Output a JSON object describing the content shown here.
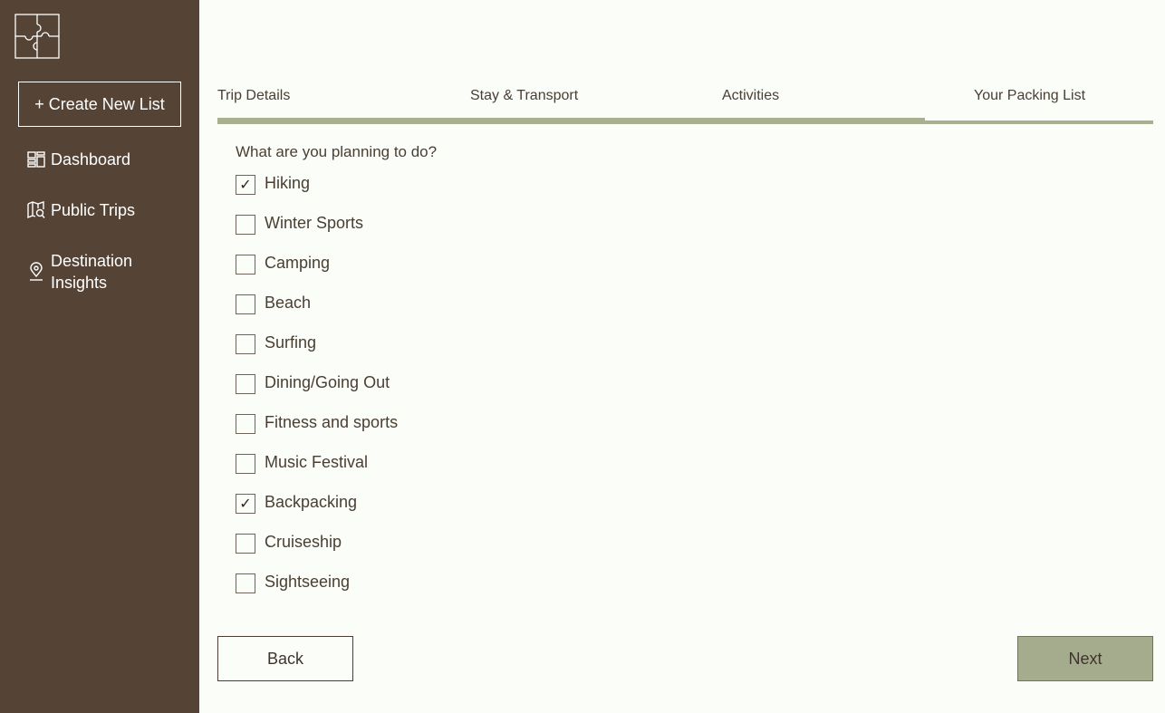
{
  "sidebar": {
    "logo_icon": "puzzle-logo",
    "create_label": "+ Create New List",
    "items": [
      {
        "icon": "dashboard-icon",
        "label": "Dashboard"
      },
      {
        "icon": "map-search-icon",
        "label": "Public Trips"
      },
      {
        "icon": "location-pin-icon",
        "label": "Destination Insights"
      }
    ]
  },
  "tabs": [
    {
      "label": "Trip Details"
    },
    {
      "label": "Stay & Transport"
    },
    {
      "label": "Activities"
    },
    {
      "label": "Your Packing List"
    }
  ],
  "progress": {
    "completed_steps": 3,
    "total_steps": 4
  },
  "form": {
    "question": "What are you planning to do?",
    "options": [
      {
        "label": "Hiking",
        "checked": true
      },
      {
        "label": "Winter Sports",
        "checked": false
      },
      {
        "label": "Camping",
        "checked": false
      },
      {
        "label": "Beach",
        "checked": false
      },
      {
        "label": "Surfing",
        "checked": false
      },
      {
        "label": "Dining/Going Out",
        "checked": false
      },
      {
        "label": "Fitness and sports",
        "checked": false
      },
      {
        "label": "Music Festival",
        "checked": false
      },
      {
        "label": "Backpacking",
        "checked": true
      },
      {
        "label": "Cruiseship",
        "checked": false
      },
      {
        "label": "Sightseeing",
        "checked": false
      }
    ],
    "check_mark": "✓"
  },
  "buttons": {
    "back": "Back",
    "next": "Next"
  },
  "colors": {
    "sidebar_bg": "#554436",
    "page_bg": "#fbfdf8",
    "accent": "#a5ac8e",
    "text": "#4a3e33"
  }
}
